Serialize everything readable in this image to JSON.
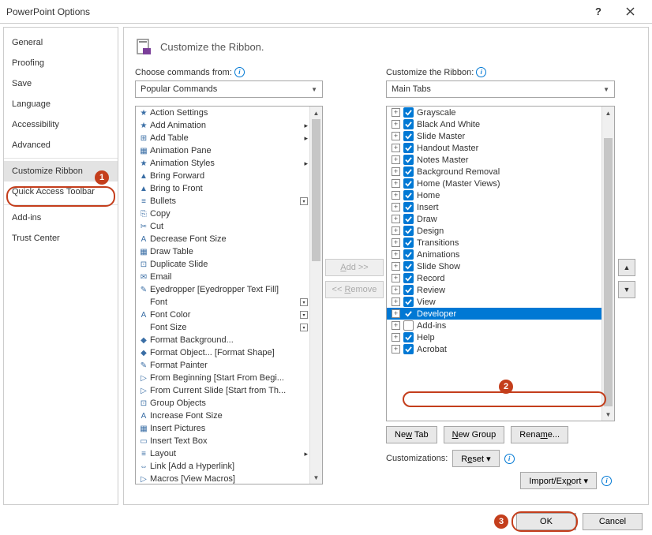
{
  "title": "PowerPoint Options",
  "sidebar": {
    "groups": [
      [
        "General",
        "Proofing",
        "Save",
        "Language",
        "Accessibility",
        "Advanced"
      ],
      [
        "Customize Ribbon",
        "Quick Access Toolbar"
      ],
      [
        "Add-ins",
        "Trust Center"
      ]
    ],
    "selected": "Customize Ribbon"
  },
  "header": "Customize the Ribbon.",
  "left": {
    "label": "Choose commands from:",
    "dropdown": "Popular Commands",
    "items": [
      {
        "icon": "★",
        "label": "Action Settings"
      },
      {
        "icon": "★",
        "label": "Add Animation",
        "sub": true
      },
      {
        "icon": "⊞",
        "label": "Add Table",
        "sub": true
      },
      {
        "icon": "▦",
        "label": "Animation Pane"
      },
      {
        "icon": "★",
        "label": "Animation Styles",
        "sub": true
      },
      {
        "icon": "▲",
        "label": "Bring Forward"
      },
      {
        "icon": "▲",
        "label": "Bring to Front"
      },
      {
        "icon": "≡",
        "label": "Bullets",
        "dd": true,
        "sub": true
      },
      {
        "icon": "⎘",
        "label": "Copy"
      },
      {
        "icon": "✂",
        "label": "Cut"
      },
      {
        "icon": "A",
        "label": "Decrease Font Size"
      },
      {
        "icon": "▦",
        "label": "Draw Table"
      },
      {
        "icon": "⊡",
        "label": "Duplicate Slide"
      },
      {
        "icon": "✉",
        "label": "Email"
      },
      {
        "icon": "✎",
        "label": "Eyedropper [Eyedropper Text Fill]"
      },
      {
        "icon": "",
        "label": "Font",
        "dd": true
      },
      {
        "icon": "A",
        "label": "Font Color",
        "dd": true,
        "sub": true
      },
      {
        "icon": "",
        "label": "Font Size",
        "dd": true
      },
      {
        "icon": "◆",
        "label": "Format Background..."
      },
      {
        "icon": "◆",
        "label": "Format Object... [Format Shape]"
      },
      {
        "icon": "✎",
        "label": "Format Painter"
      },
      {
        "icon": "▷",
        "label": "From Beginning [Start From Begi..."
      },
      {
        "icon": "▷",
        "label": "From Current Slide [Start from Th..."
      },
      {
        "icon": "⊡",
        "label": "Group Objects"
      },
      {
        "icon": "A",
        "label": "Increase Font Size"
      },
      {
        "icon": "▦",
        "label": "Insert Pictures"
      },
      {
        "icon": "▭",
        "label": "Insert Text Box"
      },
      {
        "icon": "≡",
        "label": "Layout",
        "sub": true
      },
      {
        "icon": "⇔",
        "label": "Link [Add a Hyperlink]"
      },
      {
        "icon": "▷",
        "label": "Macros [View Macros]"
      }
    ]
  },
  "mid": {
    "add": "Add >>",
    "remove": "<< Remove"
  },
  "right": {
    "label": "Customize the Ribbon:",
    "dropdown": "Main Tabs",
    "items": [
      {
        "label": "Grayscale",
        "chk": true
      },
      {
        "label": "Black And White",
        "chk": true
      },
      {
        "label": "Slide Master",
        "chk": true
      },
      {
        "label": "Handout Master",
        "chk": true
      },
      {
        "label": "Notes Master",
        "chk": true
      },
      {
        "label": "Background Removal",
        "chk": true
      },
      {
        "label": "Home (Master Views)",
        "chk": true
      },
      {
        "label": "Home",
        "chk": true
      },
      {
        "label": "Insert",
        "chk": true
      },
      {
        "label": "Draw",
        "chk": true
      },
      {
        "label": "Design",
        "chk": true
      },
      {
        "label": "Transitions",
        "chk": true
      },
      {
        "label": "Animations",
        "chk": true
      },
      {
        "label": "Slide Show",
        "chk": true
      },
      {
        "label": "Record",
        "chk": true
      },
      {
        "label": "Review",
        "chk": true
      },
      {
        "label": "View",
        "chk": true
      },
      {
        "label": "Developer",
        "chk": true,
        "sel": true
      },
      {
        "label": "Add-ins",
        "chk": false
      },
      {
        "label": "Help",
        "chk": true
      },
      {
        "label": "Acrobat",
        "chk": true
      }
    ],
    "newTab": "New Tab",
    "newGroup": "New Group",
    "rename": "Rename...",
    "customizations": "Customizations:",
    "reset": "Reset",
    "impexp": "Import/Export"
  },
  "footer": {
    "ok": "OK",
    "cancel": "Cancel"
  },
  "anno": {
    "a1": "1",
    "a2": "2",
    "a3": "3"
  }
}
